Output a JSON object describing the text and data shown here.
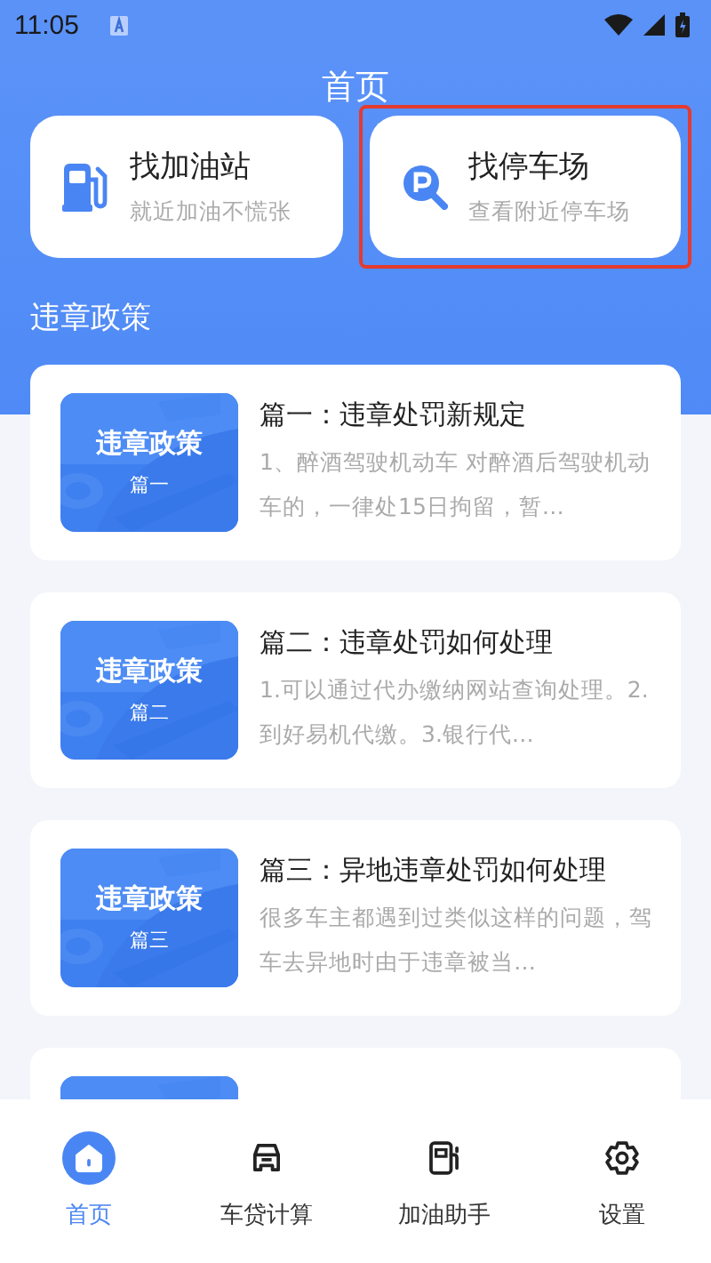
{
  "status_bar": {
    "time": "11:05"
  },
  "header": {
    "title": "首页"
  },
  "quick_actions": [
    {
      "kind": "fuel",
      "title": "找加油站",
      "subtitle": "就近加油不慌张",
      "highlighted": false
    },
    {
      "kind": "parking",
      "title": "找停车场",
      "subtitle": "查看附近停车场",
      "highlighted": true
    }
  ],
  "section_title": "违章政策",
  "articles": [
    {
      "thumb_title": "违章政策",
      "thumb_sub": "篇一",
      "title": "篇一：违章处罚新规定",
      "summary": "1、醉酒驾驶机动车 对醉酒后驾驶机动车的，一律处15日拘留，暂…"
    },
    {
      "thumb_title": "违章政策",
      "thumb_sub": "篇二",
      "title": "篇二：违章处罚如何处理",
      "summary": "1.可以通过代办缴纳网站查询处理。2.到好易机代缴。3.银行代…"
    },
    {
      "thumb_title": "违章政策",
      "thumb_sub": "篇三",
      "title": "篇三：异地违章处罚如何处理",
      "summary": "很多车主都遇到过类似这样的问题，驾车去异地时由于违章被当…"
    }
  ],
  "tab_bar": [
    {
      "kind": "home",
      "label": "首页",
      "selected": true
    },
    {
      "kind": "car",
      "label": "车贷计算",
      "selected": false
    },
    {
      "kind": "fuel",
      "label": "加油助手",
      "selected": false
    },
    {
      "kind": "settings",
      "label": "设置",
      "selected": false
    }
  ]
}
